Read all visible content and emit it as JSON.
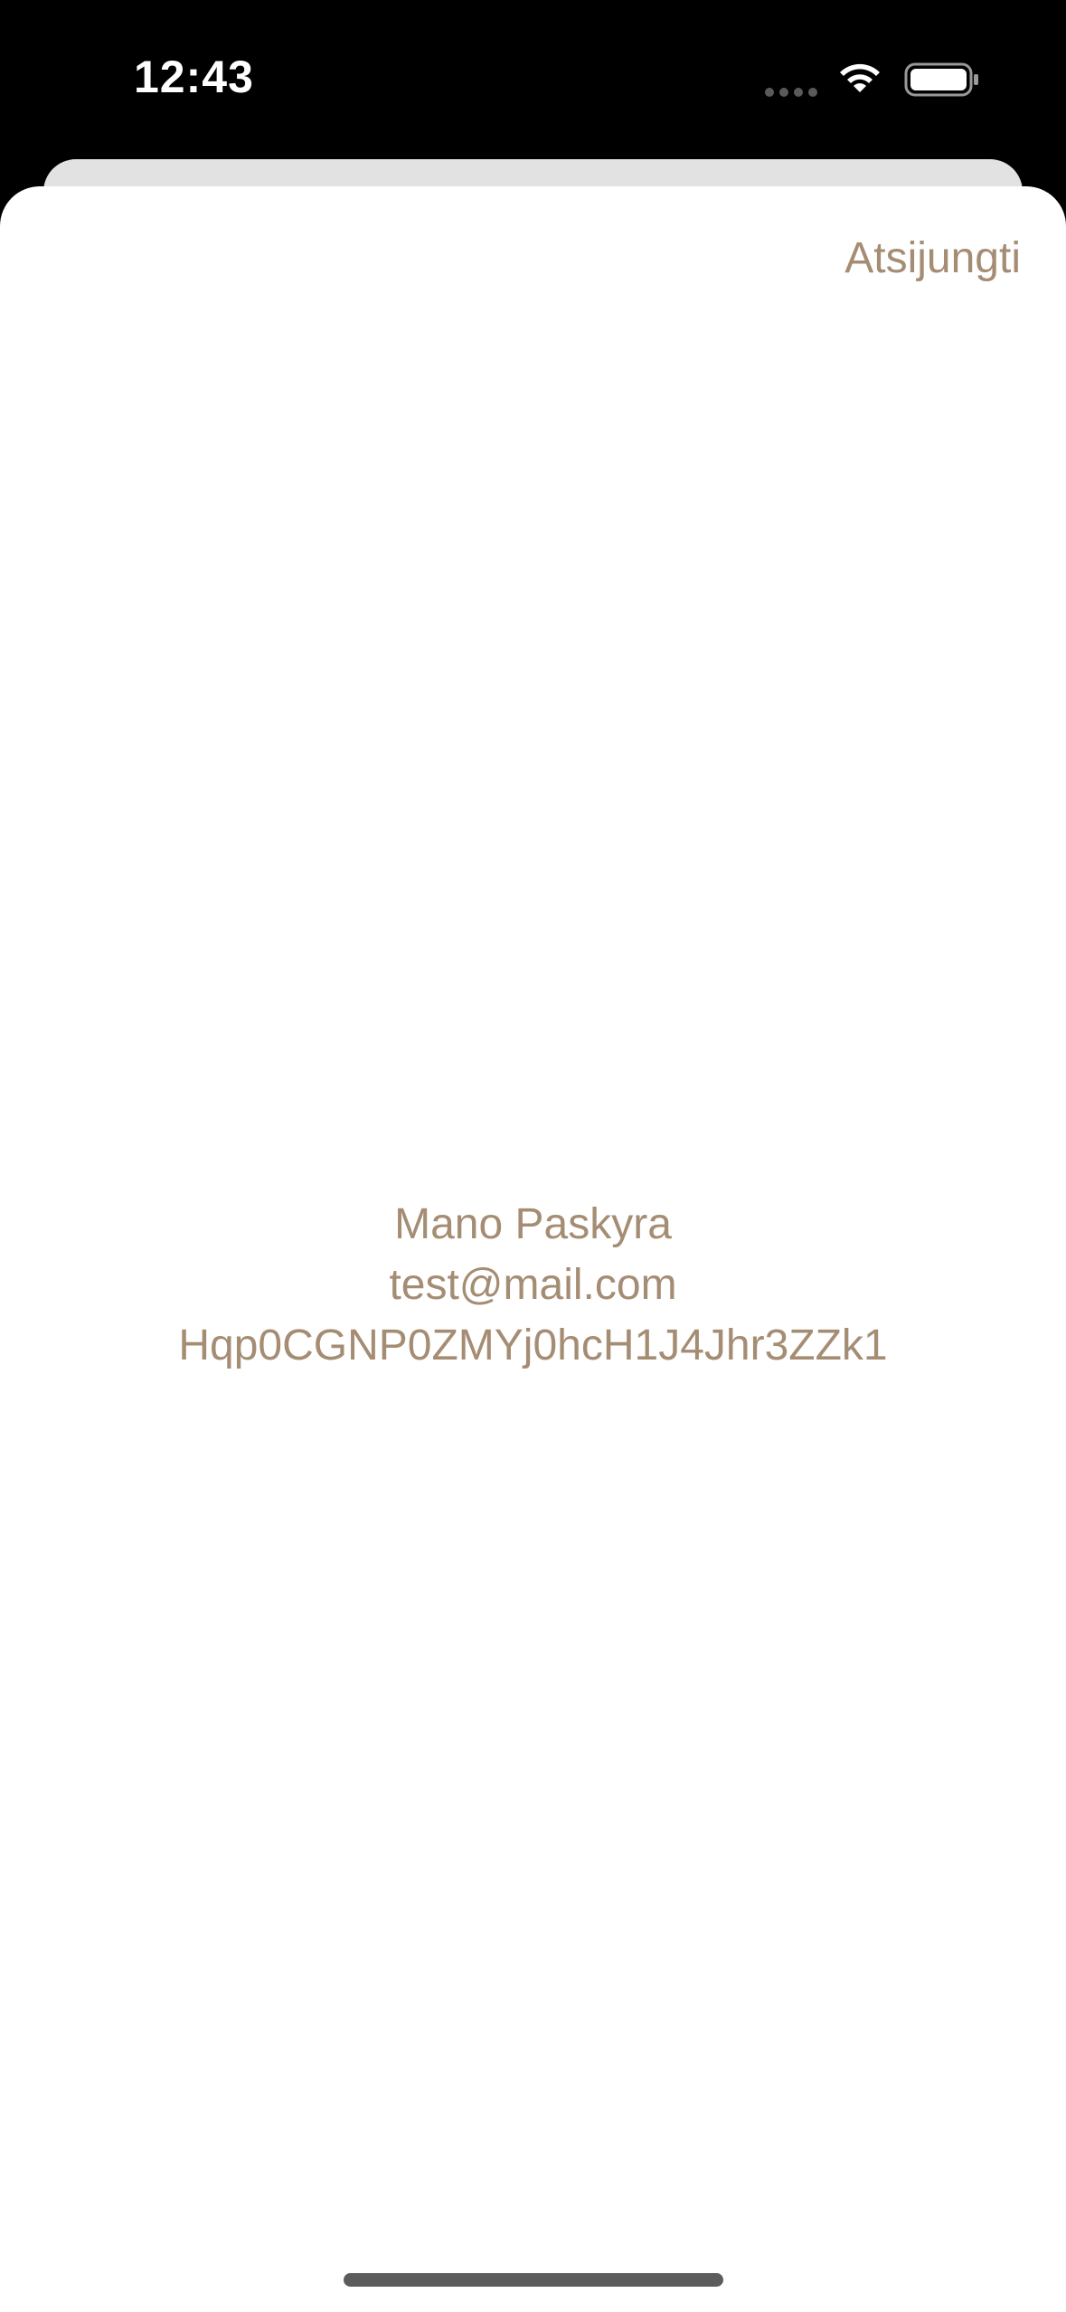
{
  "status_bar": {
    "time": "12:43",
    "icons": [
      "cellular-signal-icon",
      "wifi-icon",
      "battery-icon"
    ]
  },
  "header": {
    "logout_label": "Atsijungti"
  },
  "profile": {
    "title": "Mano Paskyra",
    "email": "test@mail.com",
    "user_id": "Hqp0CGNP0ZMYj0hcH1J4Jhr3ZZk1"
  },
  "colors": {
    "accent": "#a58d74",
    "background": "#ffffff",
    "status_bar": "#000000",
    "peek_card": "#e2e2e2"
  }
}
